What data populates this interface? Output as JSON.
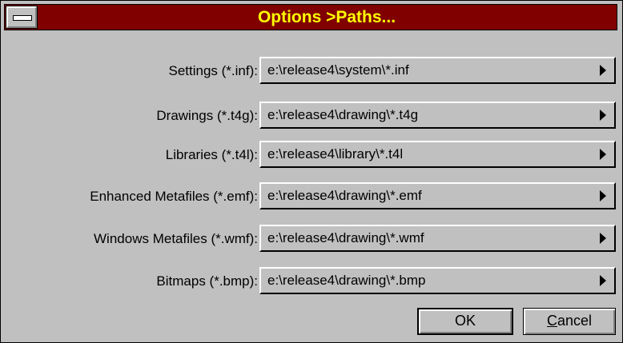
{
  "window": {
    "title": "Options >Paths..."
  },
  "paths": [
    {
      "label": "Settings (*.inf):",
      "value": "e:\\release4\\system\\*.inf"
    },
    {
      "label": "Drawings (*.t4g):",
      "value": "e:\\release4\\drawing\\*.t4g"
    },
    {
      "label": "Libraries (*.t4l):",
      "value": "e:\\release4\\library\\*.t4l"
    },
    {
      "label": "Enhanced Metafiles (*.emf):",
      "value": "e:\\release4\\drawing\\*.emf"
    },
    {
      "label": "Windows Metafiles (*.wmf):",
      "value": "e:\\release4\\drawing\\*.wmf"
    },
    {
      "label": "Bitmaps (*.bmp):",
      "value": "e:\\release4\\drawing\\*.bmp"
    }
  ],
  "buttons": {
    "ok": "OK",
    "cancel_accel": "C",
    "cancel_rest": "ancel"
  },
  "colors": {
    "titlebar": "#800000",
    "title_text": "#ffff00",
    "face": "#c0c0c0"
  },
  "icons": {
    "system_menu": "minus-bar-icon",
    "field_arrow": "triangle-right-icon"
  }
}
